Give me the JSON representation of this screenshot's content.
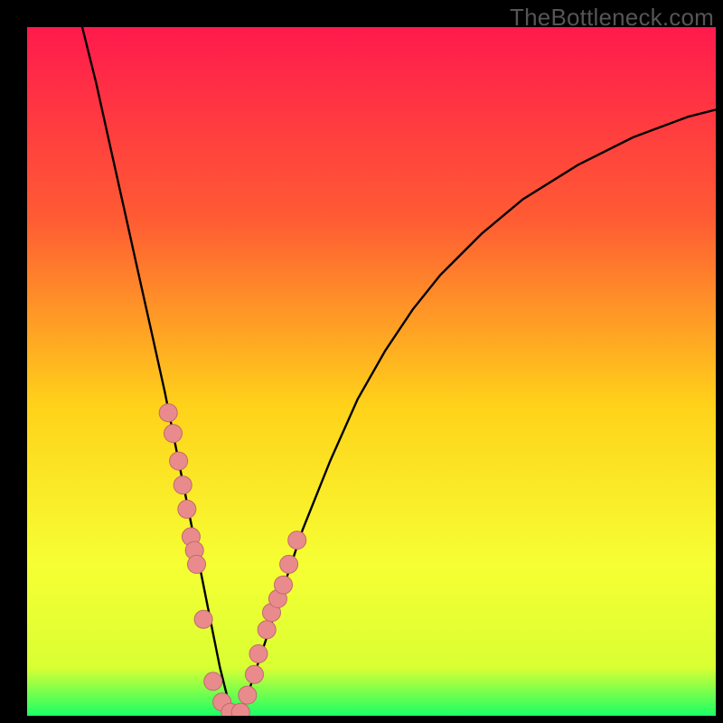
{
  "watermark": "TheBottleneck.com",
  "colors": {
    "frame": "#000000",
    "curve": "#000000",
    "marker_fill": "#e98b8c",
    "marker_stroke": "#c06a6b",
    "grad_top": "#ff1a4d",
    "grad_mid1": "#ff5c33",
    "grad_mid2": "#ffd21a",
    "grad_mid3": "#f6ff33",
    "grad_bottom_high": "#d9ff33",
    "grad_bottom_low": "#1aff66"
  },
  "chart_data": {
    "type": "line",
    "title": "",
    "xlabel": "",
    "ylabel": "",
    "xlim": [
      0,
      100
    ],
    "ylim": [
      0,
      100
    ],
    "series": [
      {
        "name": "bottleneck-curve",
        "x": [
          8,
          10,
          12,
          14,
          16,
          18,
          20,
          22,
          23,
          24,
          25,
          26,
          27,
          28,
          29,
          30,
          31,
          32,
          34,
          36,
          38,
          40,
          44,
          48,
          52,
          56,
          60,
          66,
          72,
          80,
          88,
          96,
          100
        ],
        "y": [
          100,
          92,
          83,
          74,
          65,
          56,
          47,
          37,
          32,
          27,
          22,
          17,
          12,
          7,
          3,
          0,
          0,
          3,
          9,
          15,
          21,
          27,
          37,
          46,
          53,
          59,
          64,
          70,
          75,
          80,
          84,
          87,
          88
        ]
      }
    ],
    "markers": {
      "name": "highlighted-points",
      "x": [
        20.5,
        21.2,
        22.0,
        22.6,
        23.2,
        23.8,
        24.3,
        24.6,
        25.6,
        27.0,
        28.3,
        29.5,
        31.0,
        32.0,
        33.0,
        33.6,
        34.8,
        35.5,
        36.4,
        37.2,
        38.0,
        39.2
      ],
      "y": [
        44.0,
        41.0,
        37.0,
        33.5,
        30.0,
        26.0,
        24.0,
        22.0,
        14.0,
        5.0,
        2.0,
        0.5,
        0.5,
        3.0,
        6.0,
        9.0,
        12.5,
        15.0,
        17.0,
        19.0,
        22.0,
        25.5
      ]
    }
  }
}
